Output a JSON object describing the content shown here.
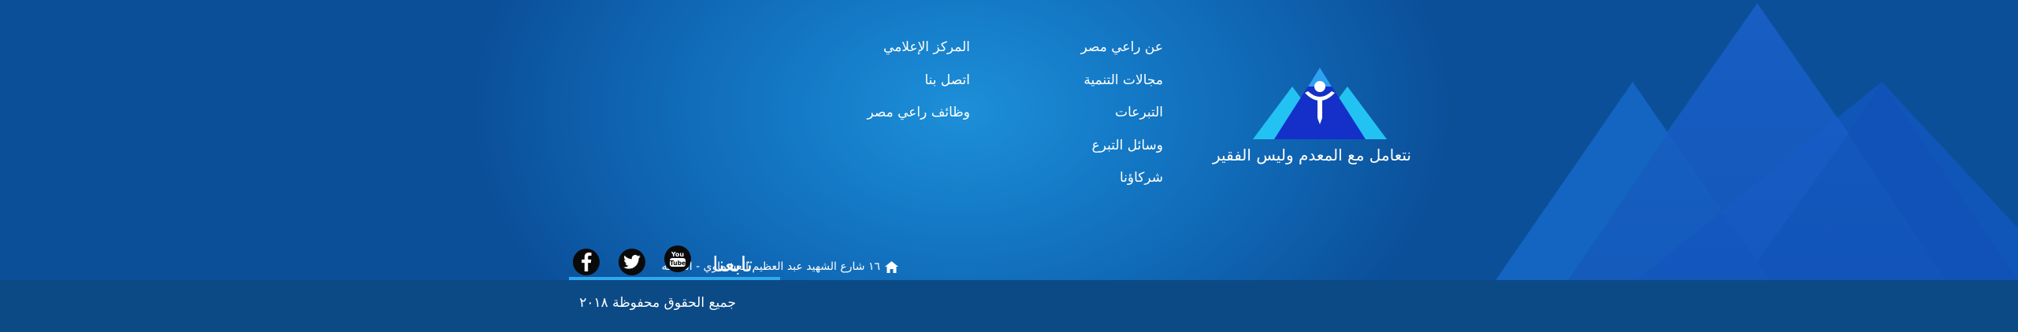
{
  "brand": {
    "tagline": "نتعامل مع المعدم وليس الفقير"
  },
  "links_col1": [
    {
      "label": "عن راعي مصر"
    },
    {
      "label": "مجالات التنمية"
    },
    {
      "label": "التبرعات"
    },
    {
      "label": "وسائل التبرع"
    },
    {
      "label": "شركاؤنا"
    }
  ],
  "links_col2": [
    {
      "label": "المركز الإعلامي"
    },
    {
      "label": "اتصل بنا"
    },
    {
      "label": "وظائف راعي مصر"
    }
  ],
  "address": {
    "icon": "home-icon",
    "text": "١٦ شارع الشهيد عبد العظيم العشماوي - الماظه"
  },
  "follow": {
    "title": "تابعنا",
    "social": [
      {
        "icon": "youtube-icon"
      },
      {
        "icon": "twitter-icon"
      },
      {
        "icon": "facebook-icon"
      }
    ]
  },
  "footer": {
    "copyright": "جميع الحقوق محفوظة ٢٠١٨"
  },
  "colors": {
    "background": "#1479c6",
    "bottom_bar": "#0c4a86",
    "accent_underline": "#2ea9ef",
    "logo_dark_blue": "#1530c8",
    "logo_light_blue": "#22c3f3"
  }
}
